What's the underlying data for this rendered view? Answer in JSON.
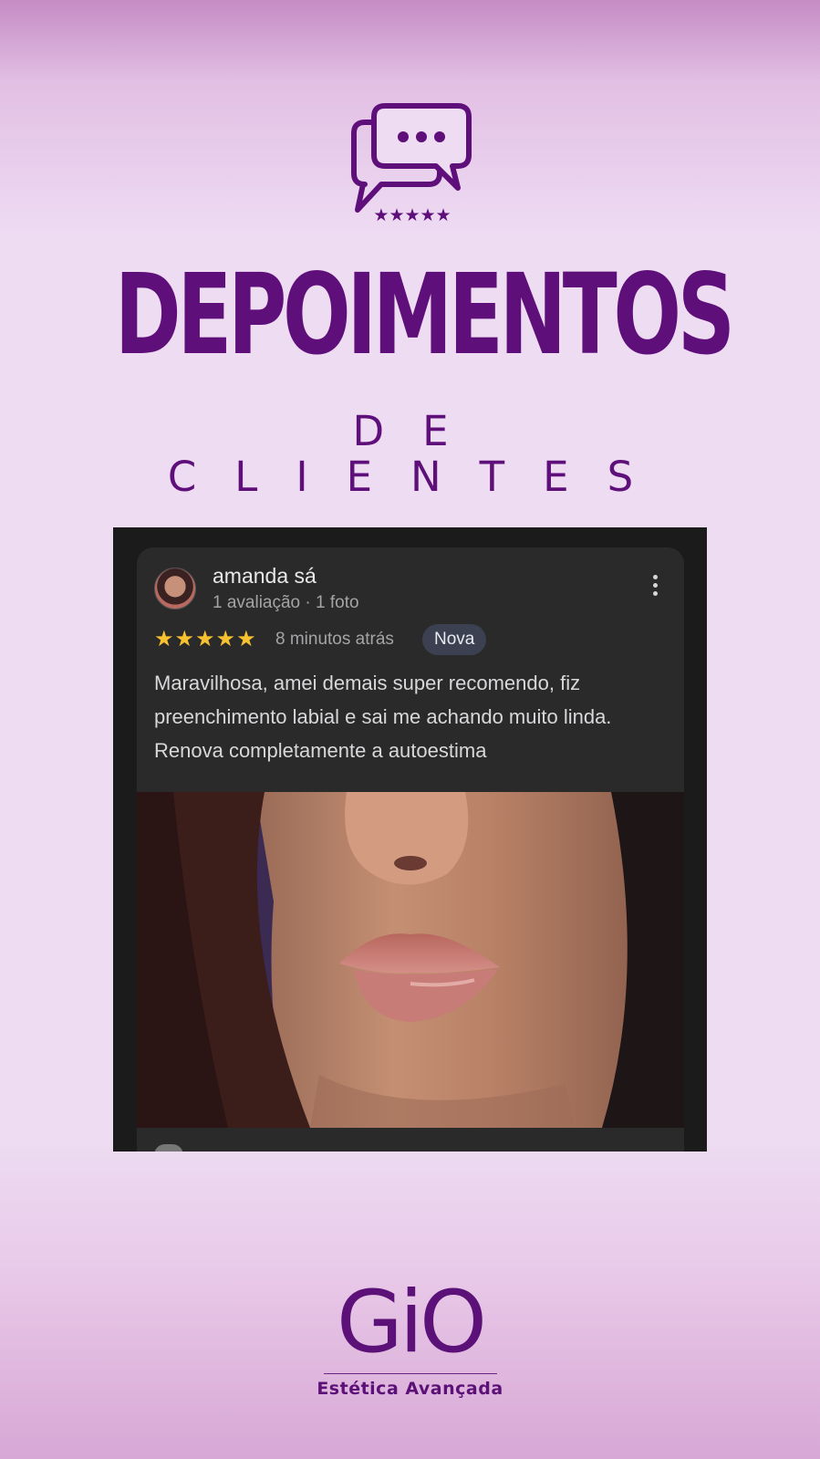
{
  "header": {
    "title": "DEPOIMENTOS",
    "subtitle": "DE CLIENTES",
    "icon": "chat-bubbles-five-stars-icon"
  },
  "review": {
    "reviewer_name": "amanda sá",
    "reviewer_meta": "1 avaliação · 1 foto",
    "rating": 5,
    "stars_text": "★★★★★",
    "time_ago": "8 minutos atrás",
    "badge": "Nova",
    "text": "Maravilhosa, amei demais super recomendo, fiz preenchimento labial e sai me achando muito linda. Renova completamente a autoestima",
    "more_icon": "vertical-ellipsis-icon",
    "star_color": "#f7c12f"
  },
  "brand": {
    "logo_text": "GiO",
    "tagline": "Estética Avançada",
    "color": "#5e0f7a"
  }
}
